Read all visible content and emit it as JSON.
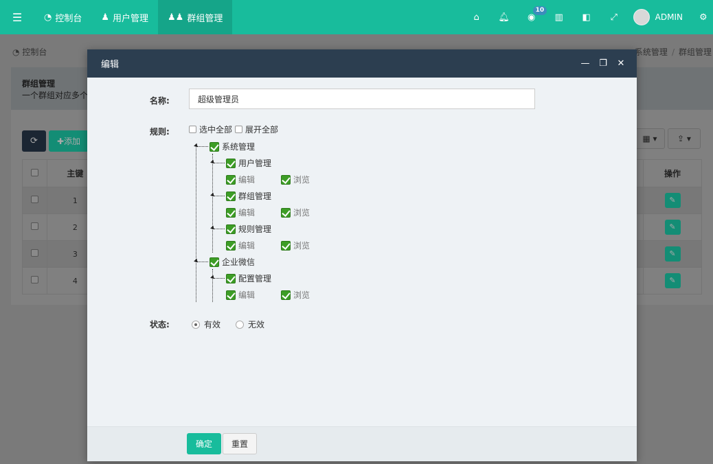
{
  "topbar": {
    "nav": [
      {
        "label": "控制台"
      },
      {
        "label": "用户管理"
      },
      {
        "label": "群组管理"
      }
    ],
    "notification_count": "10",
    "user_name": "ADMIN"
  },
  "breadcrumb": {
    "left": "控制台",
    "items": [
      "系统管理",
      "群组管理"
    ]
  },
  "panel": {
    "title": "群组管理",
    "description": "一个群组对应多个"
  },
  "toolbar": {
    "add_label": "添加"
  },
  "table": {
    "headers": {
      "pk": "主键",
      "actions": "操作"
    },
    "rows": [
      {
        "id": "1"
      },
      {
        "id": "2"
      },
      {
        "id": "3"
      },
      {
        "id": "4"
      }
    ]
  },
  "modal": {
    "title": "编辑",
    "name_label": "名称:",
    "name_value": "超级管理员",
    "rules_label": "规则:",
    "select_all": "选中全部",
    "expand_all": "展开全部",
    "tree": {
      "system": "系统管理",
      "user_mgmt": "用户管理",
      "group_mgmt": "群组管理",
      "rule_mgmt": "规则管理",
      "wechat": "企业微信",
      "config_mgmt": "配置管理",
      "edit": "编辑",
      "browse": "浏览"
    },
    "status_label": "状态:",
    "status_options": [
      "有效",
      "无效"
    ],
    "status_selected": "有效",
    "ok_button": "确定",
    "reset_button": "重置"
  }
}
